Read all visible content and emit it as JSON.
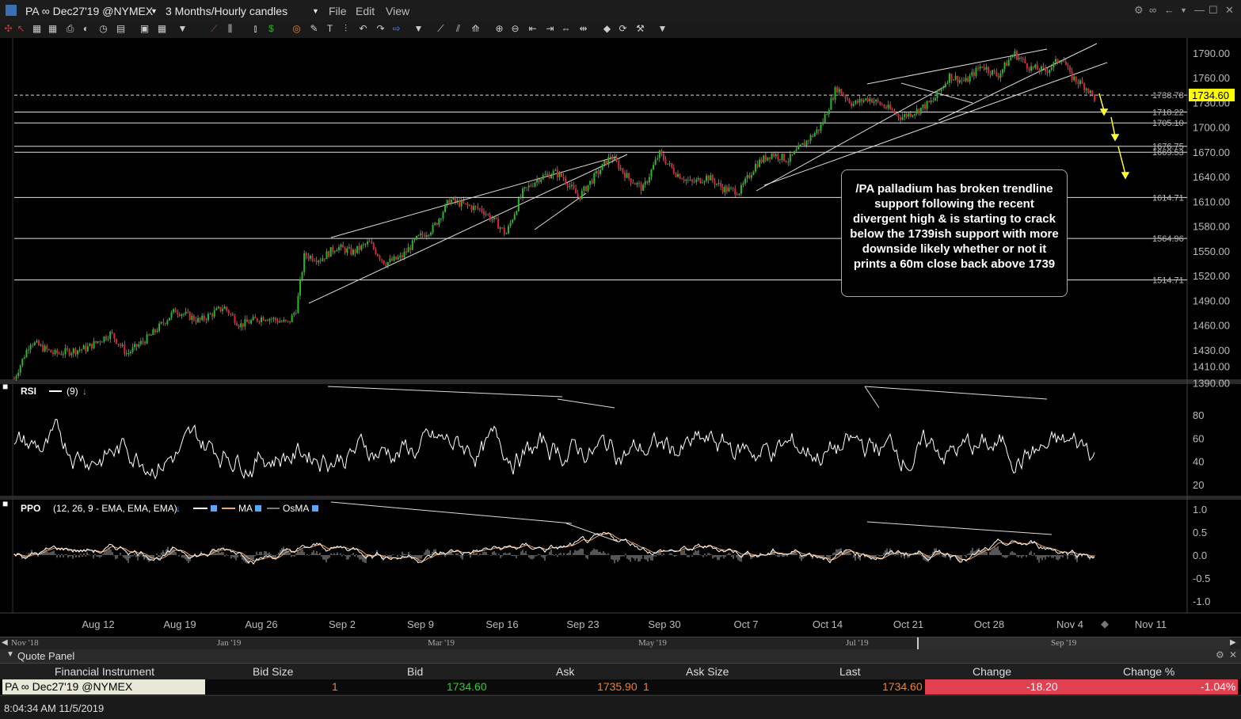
{
  "window": {
    "symbol": "PA ∞ Dec27'19 @NYMEX",
    "timeframe": "3 Months/Hourly candles",
    "menu": [
      "File",
      "Edit",
      "View"
    ]
  },
  "chart_data": {
    "type": "candlestick",
    "price_axis_ticks": [
      "1790.00",
      "1760.00",
      "1730.00",
      "1700.00",
      "1670.00",
      "1640.00",
      "1610.00",
      "1580.00",
      "1550.00",
      "1520.00",
      "1490.00",
      "1460.00",
      "1430.00",
      "1410.00",
      "1390.00"
    ],
    "last_price_label": "1734.60",
    "horizontal_levels": [
      "1738.78",
      "1718.22",
      "1705.10",
      "1676.75",
      "1669.53",
      "1614.71",
      "1564.96",
      "1514.71"
    ],
    "x_labels": [
      "Aug 12",
      "Aug 19",
      "Aug 26",
      "Sep 2",
      "Sep 9",
      "Sep 16",
      "Sep 23",
      "Sep 30",
      "Oct 7",
      "Oct 14",
      "Oct 21",
      "Oct 28",
      "Nov 4",
      "Nov 11"
    ],
    "price_path": [
      [
        0,
        1395
      ],
      [
        0.02,
        1440
      ],
      [
        0.05,
        1425
      ],
      [
        0.09,
        1432
      ],
      [
        0.12,
        1450
      ],
      [
        0.14,
        1425
      ],
      [
        0.17,
        1448
      ],
      [
        0.2,
        1478
      ],
      [
        0.23,
        1465
      ],
      [
        0.26,
        1482
      ],
      [
        0.28,
        1460
      ],
      [
        0.31,
        1470
      ],
      [
        0.34,
        1462
      ],
      [
        0.35,
        1480
      ],
      [
        0.36,
        1545
      ],
      [
        0.38,
        1540
      ],
      [
        0.4,
        1555
      ],
      [
        0.42,
        1548
      ],
      [
        0.44,
        1560
      ],
      [
        0.46,
        1535
      ],
      [
        0.48,
        1542
      ],
      [
        0.5,
        1565
      ],
      [
        0.52,
        1578
      ],
      [
        0.54,
        1612
      ],
      [
        0.56,
        1605
      ],
      [
        0.58,
        1600
      ],
      [
        0.6,
        1582
      ],
      [
        0.61,
        1570
      ],
      [
        0.63,
        1620
      ],
      [
        0.65,
        1638
      ],
      [
        0.67,
        1645
      ],
      [
        0.68,
        1640
      ],
      [
        0.7,
        1615
      ],
      [
        0.72,
        1640
      ],
      [
        0.74,
        1665
      ],
      [
        0.76,
        1640
      ],
      [
        0.78,
        1625
      ],
      [
        0.8,
        1668
      ],
      [
        0.82,
        1645
      ],
      [
        0.84,
        1632
      ],
      [
        0.86,
        1640
      ],
      [
        0.88,
        1625
      ],
      [
        0.9,
        1622
      ],
      [
        0.92,
        1655
      ],
      [
        0.94,
        1668
      ],
      [
        0.96,
        1660
      ],
      [
        0.98,
        1680
      ],
      [
        1.0,
        1700
      ],
      [
        1.02,
        1748
      ],
      [
        1.04,
        1728
      ],
      [
        1.06,
        1735
      ],
      [
        1.08,
        1725
      ],
      [
        1.1,
        1712
      ],
      [
        1.12,
        1720
      ],
      [
        1.14,
        1732
      ],
      [
        1.16,
        1762
      ],
      [
        1.18,
        1755
      ],
      [
        1.2,
        1775
      ],
      [
        1.22,
        1762
      ],
      [
        1.24,
        1790
      ],
      [
        1.26,
        1772
      ],
      [
        1.28,
        1768
      ],
      [
        1.3,
        1785
      ],
      [
        1.31,
        1762
      ],
      [
        1.33,
        1748
      ],
      [
        1.34,
        1734.6
      ]
    ],
    "annotation": "/PA palladium has broken trendline support following the recent divergent high & is starting to crack below the 1739ish support  with more downside likely whether or not it prints a 60m close back above 1739",
    "rsi": {
      "title": "RSI",
      "params": "(9)",
      "ticks": [
        "80",
        "60",
        "40",
        "20"
      ]
    },
    "ppo": {
      "title": "PPO",
      "params": "(12, 26, 9 - EMA, EMA, EMA)",
      "legend": [
        "MA",
        "OsMA"
      ],
      "ticks": [
        "1.0",
        "0.5",
        "0.0",
        "-0.5",
        "-1.0"
      ]
    },
    "colors": {
      "up": "#22bb22",
      "down": "#dd2233",
      "ppo": "#f4a460",
      "last_price_bg": "#ffff00"
    }
  },
  "navigator": {
    "labels": [
      "Nov '18",
      "Jan '19",
      "Mar '19",
      "May '19",
      "Jul '19",
      "Sep '19"
    ]
  },
  "quote_panel": {
    "title": "Quote Panel",
    "headers": [
      "Financial Instrument",
      "Bid Size",
      "Bid",
      "Ask",
      "Ask Size",
      "Last",
      "Change",
      "Change %"
    ],
    "row": {
      "instrument": "PA ∞ Dec27'19 @NYMEX",
      "bid_size": "1",
      "bid": "1734.60",
      "ask": "1735.90",
      "ask_size": "1",
      "last": "1734.60",
      "change": "-18.20",
      "change_pct": "-1.04%"
    }
  },
  "status": {
    "timestamp": "8:04:34 AM 11/5/2019"
  }
}
